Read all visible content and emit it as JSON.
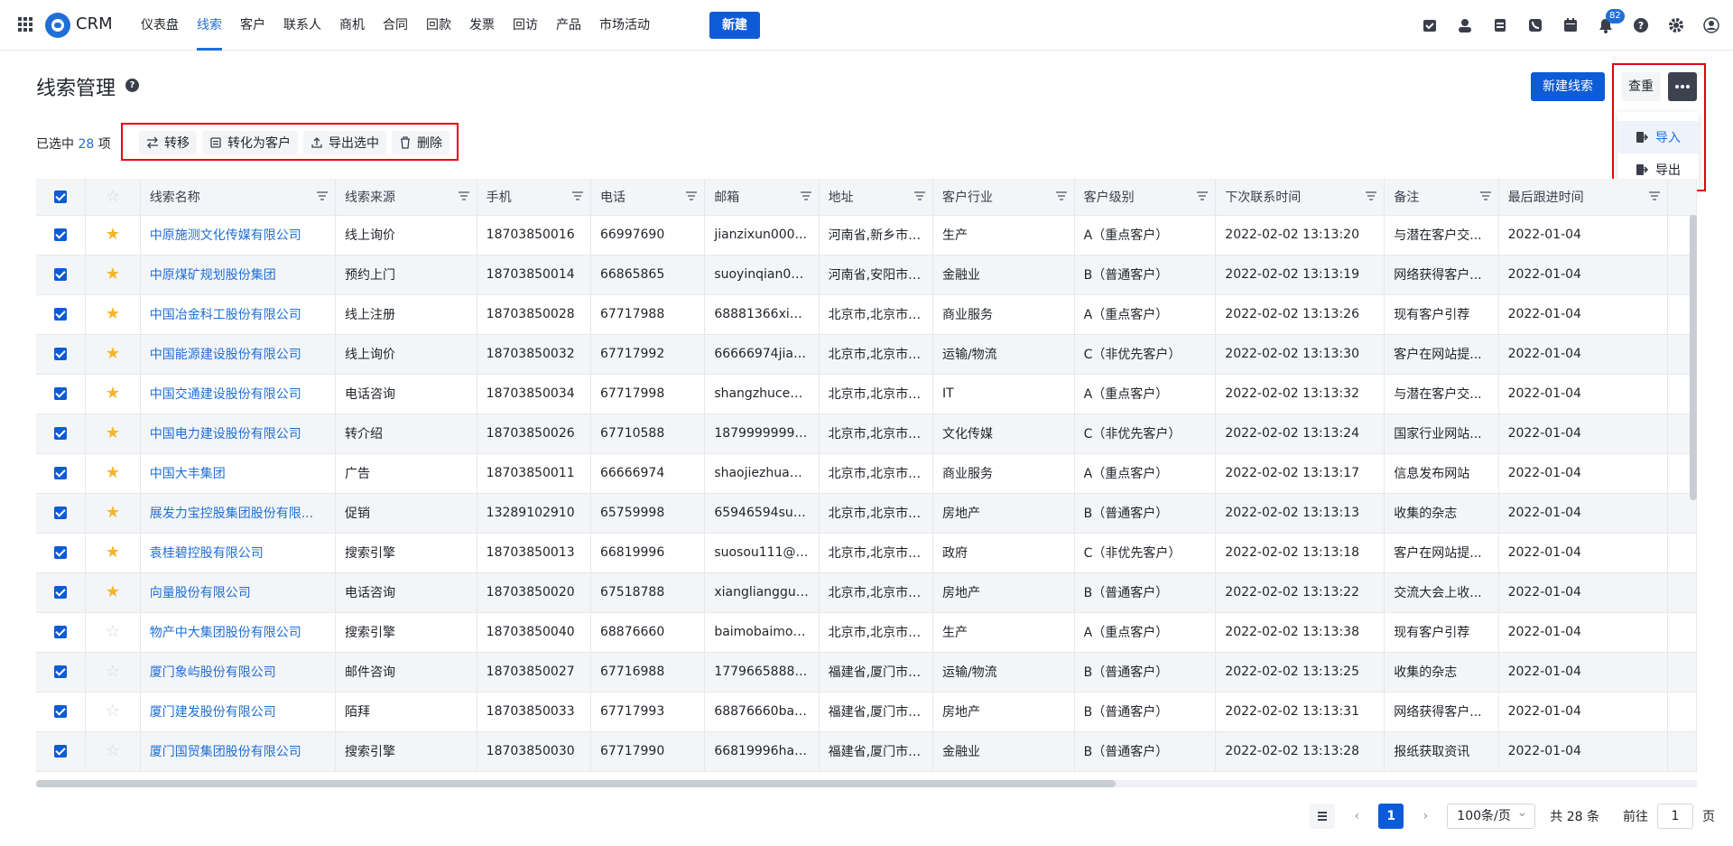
{
  "app": {
    "name": "CRM"
  },
  "nav": {
    "items": [
      "仪表盘",
      "线索",
      "客户",
      "联系人",
      "商机",
      "合同",
      "回款",
      "发票",
      "回访",
      "产品",
      "市场活动"
    ],
    "new_label": "新建",
    "notification_count": "82"
  },
  "page": {
    "title": "线索管理",
    "help": "?",
    "new_lead_label": "新建线索",
    "dedupe_label": "查重"
  },
  "more_menu": {
    "import_label": "导入",
    "export_label": "导出"
  },
  "selection": {
    "prefix": "已选中",
    "count": "28",
    "suffix": "项"
  },
  "toolbar": {
    "transfer": "转移",
    "convert": "转化为客户",
    "export_selected": "导出选中",
    "delete": "删除"
  },
  "table": {
    "columns": [
      "线索名称",
      "线索来源",
      "手机",
      "电话",
      "邮箱",
      "地址",
      "客户行业",
      "客户级别",
      "下次联系时间",
      "备注",
      "最后跟进时间"
    ],
    "rows": [
      {
        "star": true,
        "name": "中原施测文化传媒有限公司",
        "source": "线上询价",
        "mobile": "18703850016",
        "phone": "66997690",
        "email": "jianzixun000...",
        "address": "河南省,新乡市,...",
        "industry": "生产",
        "level": "A（重点客户）",
        "next": "2022-02-02 13:13:20",
        "note": "与潜在客户交...",
        "last": "2022-01-04"
      },
      {
        "star": true,
        "name": "中原煤矿规划股份集团",
        "source": "预约上门",
        "mobile": "18703850014",
        "phone": "66865865",
        "email": "suoyinqian000...",
        "address": "河南省,安阳市,...",
        "industry": "金融业",
        "level": "B（普通客户）",
        "next": "2022-02-02 13:13:19",
        "note": "网络获得客户...",
        "last": "2022-01-04"
      },
      {
        "star": true,
        "name": "中国冶金科工股份有限公司",
        "source": "线上注册",
        "mobile": "18703850028",
        "phone": "67717988",
        "email": "68881366xian...",
        "address": "北京市,北京市,...",
        "industry": "商业服务",
        "level": "A（重点客户）",
        "next": "2022-02-02 13:13:26",
        "note": "现有客户引荐",
        "last": "2022-01-04"
      },
      {
        "star": true,
        "name": "中国能源建设股份有限公司",
        "source": "线上询价",
        "mobile": "18703850032",
        "phone": "67717992",
        "email": "66666974jian...",
        "address": "北京市,北京市,...",
        "industry": "运输/物流",
        "level": "C（非优先客户）",
        "next": "2022-02-02 13:13:30",
        "note": "客户在网站提...",
        "last": "2022-01-04"
      },
      {
        "star": true,
        "name": "中国交通建设股份有限公司",
        "source": "电话咨询",
        "mobile": "18703850034",
        "phone": "67717998",
        "email": "shangzhuce00...",
        "address": "北京市,北京市,...",
        "industry": "IT",
        "level": "A（重点客户）",
        "next": "2022-02-02 13:13:32",
        "note": "与潜在客户交...",
        "last": "2022-01-04"
      },
      {
        "star": true,
        "name": "中国电力建设股份有限公司",
        "source": "转介绍",
        "mobile": "18703850026",
        "phone": "67710588",
        "email": "18799999999z...",
        "address": "北京市,北京市,...",
        "industry": "文化传媒",
        "level": "C（非优先客户）",
        "next": "2022-02-02 13:13:24",
        "note": "国家行业网站...",
        "last": "2022-01-04"
      },
      {
        "star": true,
        "name": "中国大丰集团",
        "source": "广告",
        "mobile": "18703850011",
        "phone": "66666974",
        "email": "shaojiezhuan0...",
        "address": "北京市,北京市,...",
        "industry": "商业服务",
        "level": "A（重点客户）",
        "next": "2022-02-02 13:13:17",
        "note": "信息发布网站",
        "last": "2022-01-04"
      },
      {
        "star": true,
        "name": "展发力宝控股集团股份有限...",
        "source": "促销",
        "mobile": "13289102910",
        "phone": "65759998",
        "email": "65946594suni...",
        "address": "北京市,北京市,...",
        "industry": "房地产",
        "level": "B（普通客户）",
        "next": "2022-02-02 13:13:13",
        "note": "收集的杂志",
        "last": "2022-01-04"
      },
      {
        "star": true,
        "name": "袁桂碧控股有限公司",
        "source": "搜索引擎",
        "mobile": "18703850013",
        "phone": "66819996",
        "email": "suosou111@g...",
        "address": "北京市,北京市,...",
        "industry": "政府",
        "level": "C（非优先客户）",
        "next": "2022-02-02 13:13:18",
        "note": "客户在网站提...",
        "last": "2022-01-04"
      },
      {
        "star": true,
        "name": "向量股份有限公司",
        "source": "电话咨询",
        "mobile": "18703850020",
        "phone": "67518788",
        "email": "xiangliangguf...",
        "address": "北京市,北京市,...",
        "industry": "房地产",
        "level": "B（普通客户）",
        "next": "2022-02-02 13:13:22",
        "note": "交流大会上收...",
        "last": "2022-01-04"
      },
      {
        "star": false,
        "name": "物产中大集团股份有限公司",
        "source": "搜索引擎",
        "mobile": "18703850040",
        "phone": "68876660",
        "email": "baimobaimo0...",
        "address": "北京市,北京市,...",
        "industry": "生产",
        "level": "A（重点客户）",
        "next": "2022-02-02 13:13:38",
        "note": "现有客户引荐",
        "last": "2022-01-04"
      },
      {
        "star": false,
        "name": "厦门象屿股份有限公司",
        "source": "邮件咨询",
        "mobile": "18703850027",
        "phone": "67716988",
        "email": "17796658888d...",
        "address": "福建省,厦门市,...",
        "industry": "运输/物流",
        "level": "B（普通客户）",
        "next": "2022-02-02 13:13:25",
        "note": "收集的杂志",
        "last": "2022-01-04"
      },
      {
        "star": false,
        "name": "厦门建发股份有限公司",
        "source": "陌拜",
        "mobile": "18703850033",
        "phone": "67717993",
        "email": "68876660baol...",
        "address": "福建省,厦门市,...",
        "industry": "房地产",
        "level": "B（普通客户）",
        "next": "2022-02-02 13:13:31",
        "note": "网络获得客户...",
        "last": "2022-01-04"
      },
      {
        "star": false,
        "name": "厦门国贸集团股份有限公司",
        "source": "搜索引擎",
        "mobile": "18703850030",
        "phone": "67717990",
        "email": "66819996hang...",
        "address": "福建省,厦门市,...",
        "industry": "金融业",
        "level": "B（普通客户）",
        "next": "2022-02-02 13:13:28",
        "note": "报纸获取资讯",
        "last": "2022-01-04"
      }
    ]
  },
  "pagination": {
    "current_page": "1",
    "page_size": "100条/页",
    "total": "共 28 条",
    "goto_prefix": "前往",
    "goto_value": "1",
    "goto_suffix": "页"
  },
  "colors": {
    "accent": "#0d5bd7",
    "link": "#1f6fd6",
    "star": "#f5b526",
    "highlight_box": "#e60012"
  }
}
